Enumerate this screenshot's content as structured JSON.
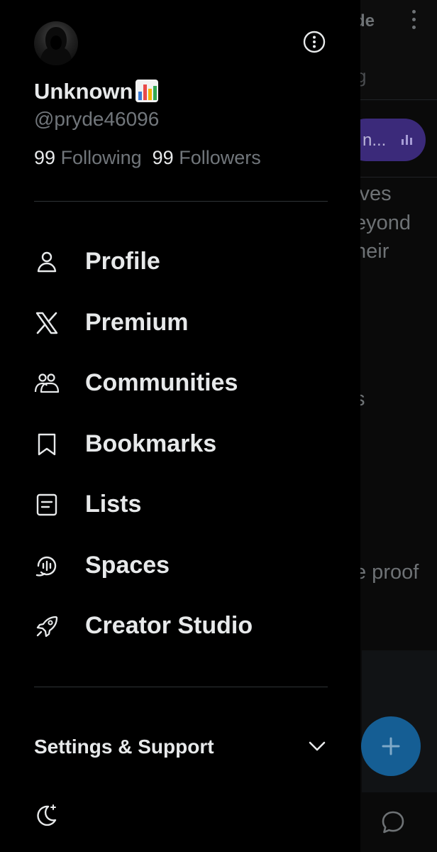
{
  "background": {
    "title_fragment": "de",
    "tab_fragment": "g",
    "pill_text": "n...",
    "post_lines": [
      "lves",
      "eyond",
      "heir"
    ],
    "fragment_s": "s",
    "fragment_proof": "e proof"
  },
  "profile": {
    "name": "Unknown",
    "handle": "@pryde46096",
    "following_count": "99",
    "following_label": "Following",
    "followers_count": "99",
    "followers_label": "Followers"
  },
  "menu": [
    {
      "label": "Profile",
      "icon": "person-icon"
    },
    {
      "label": "Premium",
      "icon": "x-logo-icon"
    },
    {
      "label": "Communities",
      "icon": "communities-icon"
    },
    {
      "label": "Bookmarks",
      "icon": "bookmark-icon"
    },
    {
      "label": "Lists",
      "icon": "list-icon"
    },
    {
      "label": "Spaces",
      "icon": "spaces-icon"
    },
    {
      "label": "Creator Studio",
      "icon": "rocket-icon"
    }
  ],
  "settings": {
    "label": "Settings & Support"
  },
  "colors": {
    "accent_fab": "#155e94",
    "spaces_pill": "#3b2a7a",
    "text_primary": "#e7e9ea",
    "text_secondary": "#71767b"
  }
}
